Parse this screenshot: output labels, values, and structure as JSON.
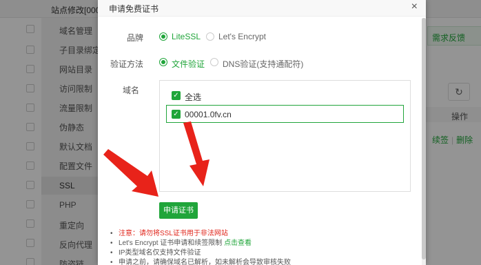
{
  "background": {
    "window_title": "站点修改[0000",
    "sidebar": [
      "域名管理",
      "子目录绑定",
      "网站目录",
      "访问限制",
      "流量限制",
      "伪静态",
      "默认文档",
      "配置文件",
      "SSL",
      "PHP",
      "重定向",
      "反向代理",
      "防盗链"
    ],
    "feedback_label": "需求反馈",
    "refresh_icon": "refresh-icon",
    "column_header": "操作",
    "row_links": [
      "续签",
      "删除"
    ]
  },
  "modal": {
    "title": "申请免费证书",
    "close": "×",
    "brand_label": "品牌",
    "brand_options": [
      "LiteSSL",
      "Let's Encrypt"
    ],
    "method_label": "验证方法",
    "method_options": [
      "文件验证",
      "DNS验证(支持通配符)"
    ],
    "domain_label": "域名",
    "select_all": "全选",
    "domain": "00001.0fv.cn",
    "apply_button": "申请证书",
    "notes": {
      "warn": "注意：请勿将SSL证书用于非法网站",
      "le_prefix": "Let's Encrypt 证书申请和续签限制",
      "le_link": "点击查看",
      "ip_only_file": "IP类型域名仅支持文件验证",
      "truncated": "申请之前，请确保域名已解析，如未解析会导致审核失败"
    }
  },
  "colors": {
    "accent": "#20a53a",
    "warning": "#e0251b",
    "arrow": "#e8231a"
  }
}
